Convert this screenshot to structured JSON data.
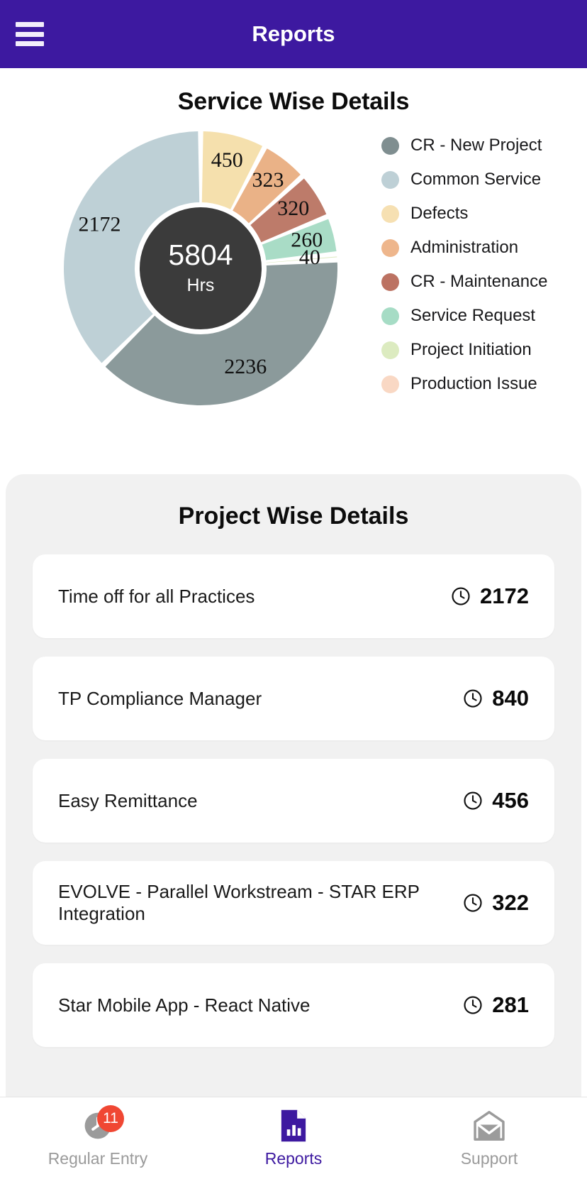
{
  "header": {
    "title": "Reports",
    "menu_icon": "hamburger-menu-icon",
    "bg_color": "#3d19a0"
  },
  "service_section": {
    "title": "Service Wise Details",
    "center_value": "5804",
    "center_unit": "Hrs"
  },
  "chart_data": {
    "type": "pie",
    "title": "Service Wise Details",
    "subtitle": "",
    "xlabel": "",
    "ylabel": "",
    "total": 5804,
    "total_unit": "Hrs",
    "legend_position": "right",
    "grid": false,
    "categories": [
      "CR - New Project",
      "Common Service",
      "Defects",
      "Administration",
      "CR - Maintenance",
      "Service Request",
      "Project Initiation",
      "Production Issue"
    ],
    "values": [
      2236,
      2172,
      450,
      323,
      320,
      260,
      40,
      3
    ],
    "labels_shown": [
      "2236",
      "2172",
      "450",
      "323",
      "320",
      "260",
      "40"
    ],
    "colors": [
      "#8b9a9b",
      "#bed0d6",
      "#f5e0ad",
      "#eab287",
      "#bd7b6a",
      "#a9dcc6",
      "#dbe8bd",
      "#f8d7c2"
    ],
    "slices": [
      {
        "label": "Defects",
        "value": 450,
        "color": "#f5e0ad",
        "display": "450"
      },
      {
        "label": "Administration",
        "value": 323,
        "color": "#eab287",
        "display": "323"
      },
      {
        "label": "CR - Maintenance",
        "value": 320,
        "color": "#bd7b6a",
        "display": "320"
      },
      {
        "label": "Service Request",
        "value": 260,
        "color": "#a9dcc6",
        "display": "260"
      },
      {
        "label": "Project Initiation",
        "value": 40,
        "color": "#dbe8bd",
        "display": "40"
      },
      {
        "label": "CR - New Project",
        "value": 2236,
        "color": "#8b9a9b",
        "display": "2236"
      },
      {
        "label": "Common Service",
        "value": 2172,
        "color": "#bed0d6",
        "display": "2172"
      }
    ]
  },
  "legend": [
    {
      "label": "CR - New Project",
      "color": "#7f8e90"
    },
    {
      "label": "Common Service",
      "color": "#bed0d6"
    },
    {
      "label": "Defects",
      "color": "#f6e0b2"
    },
    {
      "label": "Administration",
      "color": "#eeb68c"
    },
    {
      "label": "CR - Maintenance",
      "color": "#bc7262"
    },
    {
      "label": "Service Request",
      "color": "#a6dcc5"
    },
    {
      "label": "Project Initiation",
      "color": "#dcebc0"
    },
    {
      "label": "Production Issue",
      "color": "#f9d8c4"
    }
  ],
  "project_section": {
    "title": "Project Wise Details",
    "rows": [
      {
        "name": "Time off for all Practices",
        "hours": "2172"
      },
      {
        "name": "TP Compliance Manager",
        "hours": "840"
      },
      {
        "name": "Easy Remittance",
        "hours": "456"
      },
      {
        "name": "EVOLVE - Parallel Workstream - STAR ERP Integration",
        "hours": "322"
      },
      {
        "name": "Star Mobile App - React Native",
        "hours": "281"
      }
    ]
  },
  "bottom_nav": {
    "items": [
      {
        "label": "Regular Entry",
        "icon": "clock-icon",
        "badge": "11",
        "active": false
      },
      {
        "label": "Reports",
        "icon": "report-doc-icon",
        "badge": "",
        "active": true
      },
      {
        "label": "Support",
        "icon": "envelope-icon",
        "badge": "",
        "active": false
      }
    ],
    "active_color": "#3d19a0",
    "badge_color": "#f04733"
  }
}
